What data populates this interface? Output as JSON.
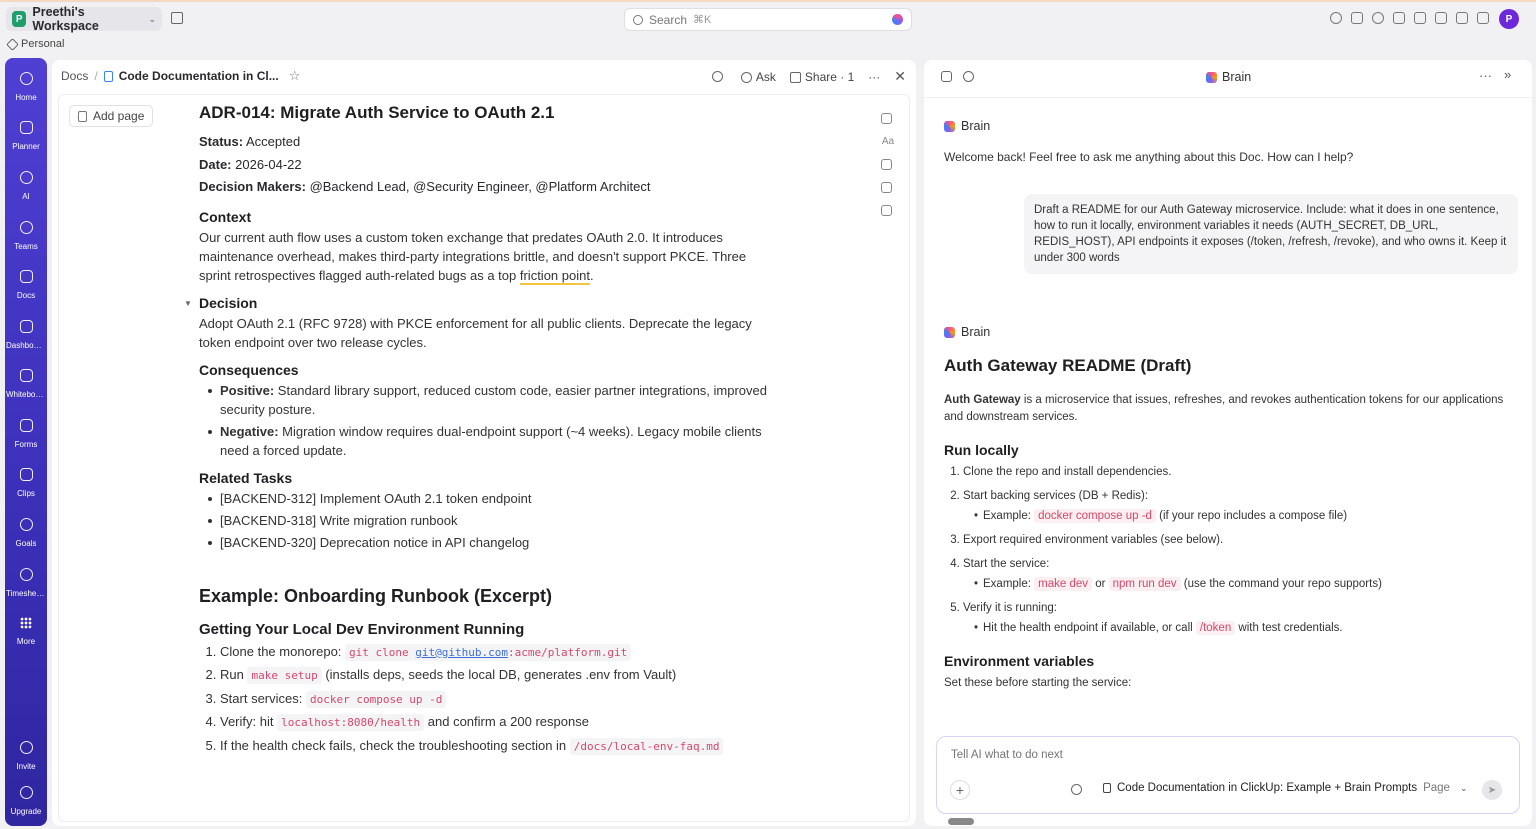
{
  "workspace": {
    "avatar": "P",
    "name": "Preethi's Workspace"
  },
  "search": {
    "placeholder": "Search",
    "shortcut": "⌘K"
  },
  "user": {
    "avatar": "P"
  },
  "personal": "Personal",
  "nav": [
    {
      "label": "Home",
      "icon": "home-icon"
    },
    {
      "label": "Planner",
      "icon": "calendar-icon"
    },
    {
      "label": "AI",
      "icon": "ai-icon"
    },
    {
      "label": "Teams",
      "icon": "teams-icon"
    },
    {
      "label": "Docs",
      "icon": "docs-icon"
    },
    {
      "label": "Dashboards",
      "icon": "dashboard-icon"
    },
    {
      "label": "Whiteboards",
      "icon": "whiteboard-icon"
    },
    {
      "label": "Forms",
      "icon": "forms-icon"
    },
    {
      "label": "Clips",
      "icon": "clips-icon"
    },
    {
      "label": "Goals",
      "icon": "trophy-icon"
    },
    {
      "label": "Timesheets",
      "icon": "clock-icon"
    },
    {
      "label": "More",
      "icon": "grid-icon"
    }
  ],
  "nav_bottom": [
    {
      "label": "Invite",
      "icon": "invite-icon"
    },
    {
      "label": "Upgrade",
      "icon": "upgrade-icon"
    }
  ],
  "doc": {
    "breadcrumb_root": "Docs",
    "breadcrumb_title": "Code Documentation in Cl...",
    "actions": {
      "ask": "Ask",
      "share": "Share · 1"
    },
    "add_page": "Add page",
    "title": "ADR-014: Migrate Auth Service to OAuth 2.1",
    "status_label": "Status:",
    "status": "Accepted",
    "date_label": "Date:",
    "date": "2026-04-22",
    "makers_label": "Decision Makers:",
    "makers": "@Backend Lead, @Security Engineer, @Platform Architect",
    "context_h": "Context",
    "context_p1": "Our current auth flow uses a custom token exchange that predates OAuth 2.0. It introduces maintenance overhead, makes third-party integrations brittle, and doesn't support PKCE. Three sprint retrospectives flagged auth-related bugs as a top ",
    "context_u": "friction point",
    "context_end": ".",
    "decision_h": "Decision",
    "decision_p": "Adopt OAuth 2.1 (RFC 9728) with PKCE enforcement for all public clients. Deprecate the legacy token endpoint over two release cycles.",
    "consequences_h": "Consequences",
    "pos_label": "Positive:",
    "pos": " Standard library support, reduced custom code, easier partner integrations, improved security posture.",
    "neg_label": "Negative:",
    "neg": " Migration window requires dual-endpoint support (~4 weeks). Legacy mobile clients need a forced update.",
    "tasks_h": "Related Tasks",
    "tasks": [
      "[BACKEND-312] Implement OAuth 2.1 token endpoint",
      "[BACKEND-318] Write migration runbook",
      "[BACKEND-320] Deprecation notice in API changelog"
    ],
    "example_h": "Example: Onboarding Runbook (Excerpt)",
    "local_h": "Getting Your Local Dev Environment Running",
    "steps": {
      "s1a": "Clone the monorepo: ",
      "s1code": "git clone ",
      "s1link": "git@github.com",
      "s1rest": ":acme/platform.git",
      "s2a": "Run ",
      "s2code": "make setup",
      "s2b": " (installs deps, seeds the local DB, generates .env from Vault)",
      "s3a": "Start services: ",
      "s3code": "docker compose up -d",
      "s4a": "Verify: hit ",
      "s4code": "localhost:8080/health",
      "s4b": " and confirm a 200 response",
      "s5a": "If the health check fails, check the troubleshooting section in ",
      "s5code": "/docs/local-env-faq.md"
    }
  },
  "brain": {
    "title": "Brain",
    "tag": "Brain",
    "welcome": "Welcome back! Feel free to ask me anything about this Doc. How can I help?",
    "user_msg": "Draft a README for our Auth Gateway microservice. Include: what it does in one sentence, how to run it locally, environment variables it needs (AUTH_SECRET, DB_URL, REDIS_HOST), API endpoints it exposes (/token, /refresh, /revoke), and who owns it. Keep it under 300 words",
    "answer_title": "Auth Gateway README (Draft)",
    "intro_b": "Auth Gateway",
    "intro": " is a microservice that issues, refreshes, and revokes authentication tokens for our applications and downstream services.",
    "run_h": "Run locally",
    "r1": "Clone the repo and install dependencies.",
    "r2": "Start backing services (DB + Redis):",
    "r2ex": "Example: ",
    "r2code": "docker compose up -d",
    "r2rest": " (if your repo includes a compose file)",
    "r3": "Export required environment variables (see below).",
    "r4": "Start the service:",
    "r4ex": "Example: ",
    "r4c1": "make dev",
    "r4or": " or ",
    "r4c2": "npm run dev",
    "r4rest": " (use the command your repo supports)",
    "r5": "Verify it is running:",
    "r5ex": "Hit the health endpoint if available, or call ",
    "r5code": "/token",
    "r5rest": " with test credentials.",
    "env_h": "Environment variables",
    "env_p": "Set these before starting the service:",
    "composer_placeholder": "Tell AI what to do next",
    "context_doc": "Code Documentation in ClickUp: Example + Brain Prompts",
    "context_type": "Page"
  }
}
